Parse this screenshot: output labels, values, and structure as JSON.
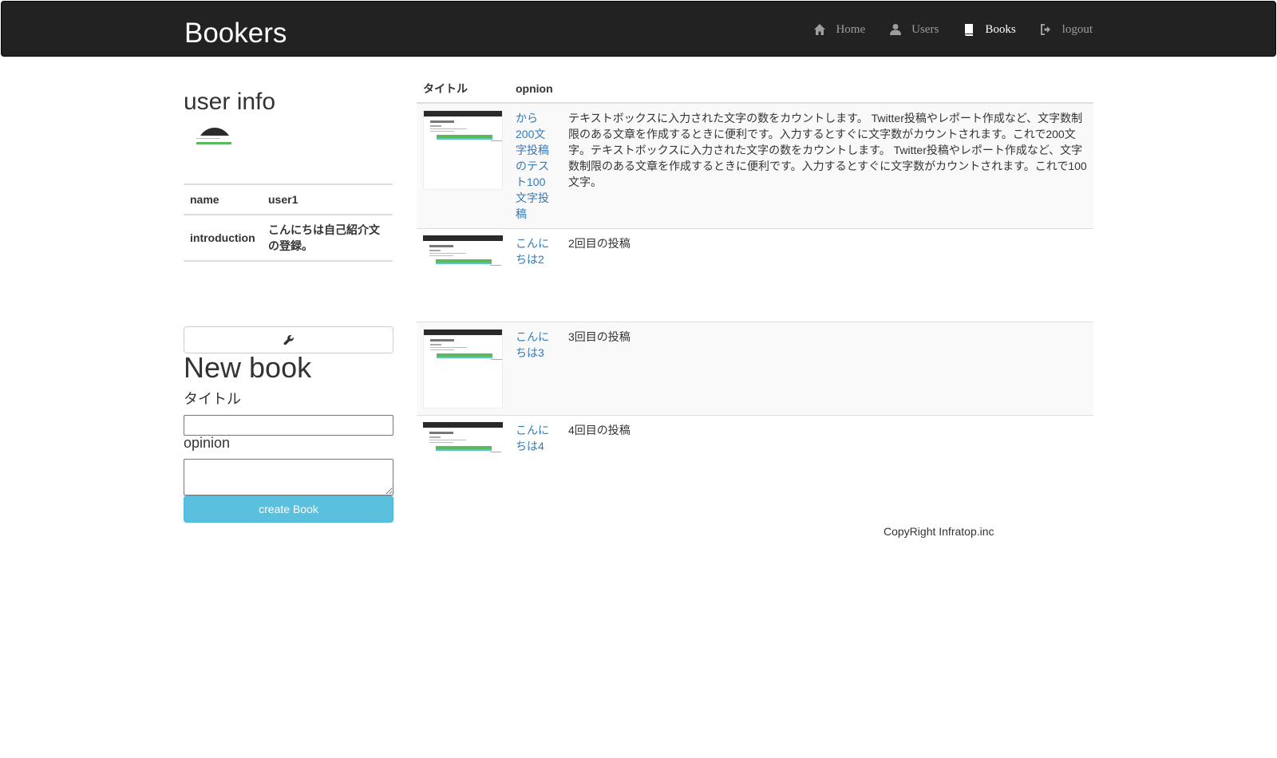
{
  "navbar": {
    "brand": "Bookers",
    "items": [
      {
        "label": "Home",
        "icon": "home-icon"
      },
      {
        "label": "Users",
        "icon": "user-icon"
      },
      {
        "label": "Books",
        "icon": "book-icon",
        "active": true
      },
      {
        "label": "logout",
        "icon": "logout-icon"
      }
    ]
  },
  "user_info": {
    "heading": "user info",
    "rows": [
      {
        "key": "name",
        "value": "user1"
      },
      {
        "key": "introduction",
        "value": "こんにちは自己紹介文の登録。"
      }
    ]
  },
  "new_book": {
    "heading": "New book",
    "title_label": "タイトル",
    "opinion_label": "opinion",
    "title_value": "",
    "opinion_value": "",
    "submit_label": "create Book"
  },
  "books": {
    "headers": [
      "タイトル",
      "opnion"
    ],
    "rows": [
      {
        "title": "から200文字投稿のテスト100文字投稿",
        "opinion": "テキストボックスに入力された文字の数をカウントします。 Twitter投稿やレポート作成など、文字数制限のある文章を作成するときに便利です。入力するとすぐに文字数がカウントされます。これで200文字。テキストボックスに入力された文字の数をカウントします。 Twitter投稿やレポート作成など、文字数制限のある文章を作成するときに便利です。入力するとすぐに文字数がカウントされます。これで100文字。"
      },
      {
        "title": "こんにちは2",
        "opinion": "2回目の投稿"
      },
      {
        "title": "こんにちは3",
        "opinion": "3回目の投稿"
      },
      {
        "title": "こんにちは4",
        "opinion": "4回目の投稿"
      }
    ]
  },
  "footer": {
    "copyright": "CopyRight Infratop.inc"
  },
  "colors": {
    "navbar_bg": "#222222",
    "link": "#337ab7",
    "info_button": "#5bc0de",
    "stripe": "#f9f9f9"
  }
}
